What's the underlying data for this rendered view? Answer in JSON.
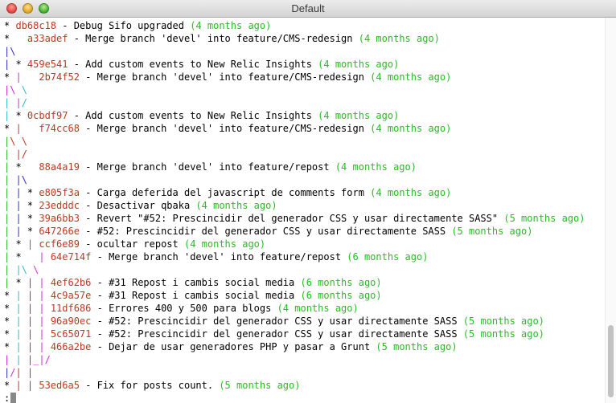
{
  "window": {
    "title": "Default"
  },
  "terminal": {
    "lines": [
      {
        "graph": [
          [
            "* ",
            "black"
          ]
        ],
        "hash": "db68c18",
        "message": " - Debug Sifo upgraded ",
        "date": "(4 months ago)"
      },
      {
        "graph": [
          [
            "*   ",
            "black"
          ]
        ],
        "hash": "a33adef",
        "message": " - Merge branch 'devel' into feature/CMS-redesign ",
        "date": "(4 months ago)"
      },
      {
        "graph": [
          [
            "|",
            "blue"
          ],
          [
            "\\",
            "blue"
          ]
        ],
        "hash": "",
        "message": "",
        "date": ""
      },
      {
        "graph": [
          [
            "| ",
            "blue"
          ],
          [
            "* ",
            "black"
          ]
        ],
        "hash": "459e541",
        "message": " - Add custom events to New Relic Insights ",
        "date": "(4 months ago)"
      },
      {
        "graph": [
          [
            "* ",
            "black"
          ],
          [
            "|   ",
            "magenta"
          ]
        ],
        "hash": "2b74f52",
        "message": " - Merge branch 'devel' into feature/CMS-redesign ",
        "date": "(4 months ago)"
      },
      {
        "graph": [
          [
            "|",
            "magenta"
          ],
          [
            "\\ ",
            "magenta"
          ],
          [
            "\\",
            "cyan"
          ]
        ],
        "hash": "",
        "message": "",
        "date": ""
      },
      {
        "graph": [
          [
            "| ",
            "cyan"
          ],
          [
            "|",
            "magenta"
          ],
          [
            "/",
            "cyan"
          ]
        ],
        "hash": "",
        "message": "",
        "date": ""
      },
      {
        "graph": [
          [
            "| ",
            "cyan"
          ],
          [
            "* ",
            "black"
          ]
        ],
        "hash": "0cbdf97",
        "message": " - Add custom events to New Relic Insights ",
        "date": "(4 months ago)"
      },
      {
        "graph": [
          [
            "* ",
            "black"
          ],
          [
            "|   ",
            "red"
          ]
        ],
        "hash": "f74cc68",
        "message": " - Merge branch 'devel' into feature/CMS-redesign ",
        "date": "(4 months ago)"
      },
      {
        "graph": [
          [
            "|",
            "green"
          ],
          [
            "\\ ",
            "red"
          ],
          [
            "\\",
            "red"
          ]
        ],
        "hash": "",
        "message": "",
        "date": ""
      },
      {
        "graph": [
          [
            "| ",
            "green"
          ],
          [
            "|",
            "red"
          ],
          [
            "/",
            "red"
          ]
        ],
        "hash": "",
        "message": "",
        "date": ""
      },
      {
        "graph": [
          [
            "| ",
            "green"
          ],
          [
            "*   ",
            "black"
          ]
        ],
        "hash": "88a4a19",
        "message": " - Merge branch 'devel' into feature/repost ",
        "date": "(4 months ago)"
      },
      {
        "graph": [
          [
            "| ",
            "green"
          ],
          [
            "|",
            "blue"
          ],
          [
            "\\",
            "blue"
          ]
        ],
        "hash": "",
        "message": "",
        "date": ""
      },
      {
        "graph": [
          [
            "| ",
            "green"
          ],
          [
            "| ",
            "blue"
          ],
          [
            "* ",
            "black"
          ]
        ],
        "hash": "e805f3a",
        "message": " - Carga deferida del javascript de comments form ",
        "date": "(4 months ago)"
      },
      {
        "graph": [
          [
            "| ",
            "green"
          ],
          [
            "| ",
            "blue"
          ],
          [
            "* ",
            "black"
          ]
        ],
        "hash": "23edddc",
        "message": " - Desactivar qbaka ",
        "date": "(4 months ago)"
      },
      {
        "graph": [
          [
            "| ",
            "green"
          ],
          [
            "| ",
            "blue"
          ],
          [
            "* ",
            "black"
          ]
        ],
        "hash": "39a6bb3",
        "message": " - Revert \"#52: Prescincidir del generador CSS y usar directamente SASS\" ",
        "date": "(5 months ago)"
      },
      {
        "graph": [
          [
            "| ",
            "green"
          ],
          [
            "| ",
            "blue"
          ],
          [
            "* ",
            "black"
          ]
        ],
        "hash": "647266e",
        "message": " - #52: Prescincidir del generador CSS y usar directamente SASS ",
        "date": "(5 months ago)"
      },
      {
        "graph": [
          [
            "| ",
            "green"
          ],
          [
            "* ",
            "black"
          ],
          [
            "| ",
            "magenta"
          ]
        ],
        "hash": "ccf6e89",
        "message": " - ocultar repost ",
        "date": "(4 months ago)"
      },
      {
        "graph": [
          [
            "| ",
            "green"
          ],
          [
            "*   ",
            "black"
          ],
          [
            "| ",
            "magenta"
          ]
        ],
        "hash": "64e714f",
        "message": " - Merge branch 'devel' into feature/repost ",
        "date": "(6 months ago)"
      },
      {
        "graph": [
          [
            "| ",
            "green"
          ],
          [
            "|",
            "cyan"
          ],
          [
            "\\ ",
            "cyan"
          ],
          [
            "\\",
            "magenta"
          ]
        ],
        "hash": "",
        "message": "",
        "date": ""
      },
      {
        "graph": [
          [
            "| ",
            "green"
          ],
          [
            "* ",
            "black"
          ],
          [
            "| ",
            "red"
          ],
          [
            "| ",
            "magenta"
          ]
        ],
        "hash": "4ef62b6",
        "message": " - #31 Repost i cambis social media ",
        "date": "(6 months ago)"
      },
      {
        "graph": [
          [
            "* ",
            "black"
          ],
          [
            "| ",
            "cyan"
          ],
          [
            "| ",
            "red"
          ],
          [
            "| ",
            "magenta"
          ]
        ],
        "hash": "4c9a57e",
        "message": " - #31 Repost i cambis social media ",
        "date": "(6 months ago)"
      },
      {
        "graph": [
          [
            "* ",
            "black"
          ],
          [
            "| ",
            "cyan"
          ],
          [
            "| ",
            "red"
          ],
          [
            "| ",
            "magenta"
          ]
        ],
        "hash": "11df686",
        "message": " - Errores 400 y 500 para blogs ",
        "date": "(4 months ago)"
      },
      {
        "graph": [
          [
            "* ",
            "black"
          ],
          [
            "| ",
            "cyan"
          ],
          [
            "| ",
            "red"
          ],
          [
            "| ",
            "magenta"
          ]
        ],
        "hash": "96a90ec",
        "message": " - #52: Prescincidir del generador CSS y usar directamente SASS ",
        "date": "(5 months ago)"
      },
      {
        "graph": [
          [
            "* ",
            "black"
          ],
          [
            "| ",
            "cyan"
          ],
          [
            "| ",
            "red"
          ],
          [
            "| ",
            "magenta"
          ]
        ],
        "hash": "5c65071",
        "message": " - #52: Prescincidir del generador CSS y usar directamente SASS ",
        "date": "(5 months ago)"
      },
      {
        "graph": [
          [
            "* ",
            "black"
          ],
          [
            "| ",
            "cyan"
          ],
          [
            "| ",
            "red"
          ],
          [
            "| ",
            "magenta"
          ]
        ],
        "hash": "466a2be",
        "message": " - Dejar de usar generadores PHP y pasar a Grunt ",
        "date": "(5 months ago)"
      },
      {
        "graph": [
          [
            "| ",
            "magenta"
          ],
          [
            "| ",
            "cyan"
          ],
          [
            "|",
            "red"
          ],
          [
            "_",
            "magenta"
          ],
          [
            "|",
            "magenta"
          ],
          [
            "/",
            "magenta"
          ]
        ],
        "hash": "",
        "message": "",
        "date": ""
      },
      {
        "graph": [
          [
            "|",
            "blue"
          ],
          [
            "/",
            "magenta"
          ],
          [
            "| ",
            "red"
          ],
          [
            "|",
            "red"
          ]
        ],
        "hash": "",
        "message": "",
        "date": ""
      },
      {
        "graph": [
          [
            "* ",
            "black"
          ],
          [
            "| ",
            "red"
          ],
          [
            "| ",
            "red"
          ]
        ],
        "hash": "53ed6a5",
        "message": " - Fix for posts count. ",
        "date": "(5 months ago)"
      }
    ],
    "prompt": ":"
  },
  "colors": {
    "hash": "#c23621",
    "date": "#25bc24",
    "background": "#ffffff"
  }
}
